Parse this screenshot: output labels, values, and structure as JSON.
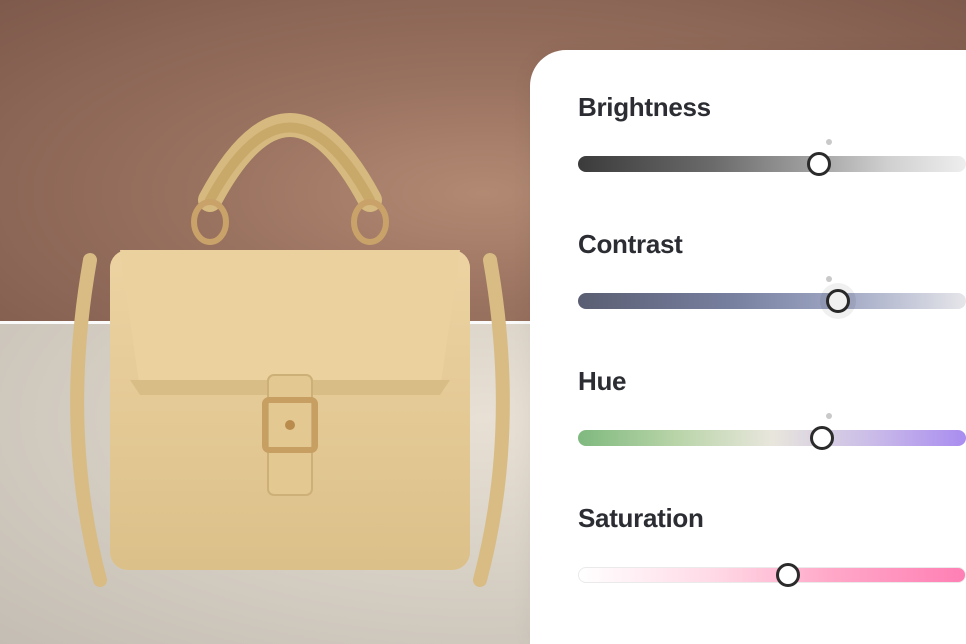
{
  "preview": {
    "subject": "tan-leather-handbag",
    "split": "horizontal-comparison",
    "top_variant": "warm-toned-background",
    "bottom_variant": "neutral-toned-background"
  },
  "controls": [
    {
      "id": "brightness",
      "label": "Brightness",
      "value_percent": 62,
      "reset_marker_percent": 64,
      "track_class": "track-brightness",
      "halo": false
    },
    {
      "id": "contrast",
      "label": "Contrast",
      "value_percent": 67,
      "reset_marker_percent": 64,
      "track_class": "track-contrast",
      "halo": true
    },
    {
      "id": "hue",
      "label": "Hue",
      "value_percent": 63,
      "reset_marker_percent": 64,
      "track_class": "track-hue",
      "halo": false
    },
    {
      "id": "saturation",
      "label": "Saturation",
      "value_percent": 54,
      "reset_marker_percent": null,
      "track_class": "track-saturation",
      "halo": false
    }
  ],
  "colors": {
    "panel_bg": "#ffffff",
    "label_text": "#2b2d33",
    "thumb_border": "#2b2b2b"
  }
}
